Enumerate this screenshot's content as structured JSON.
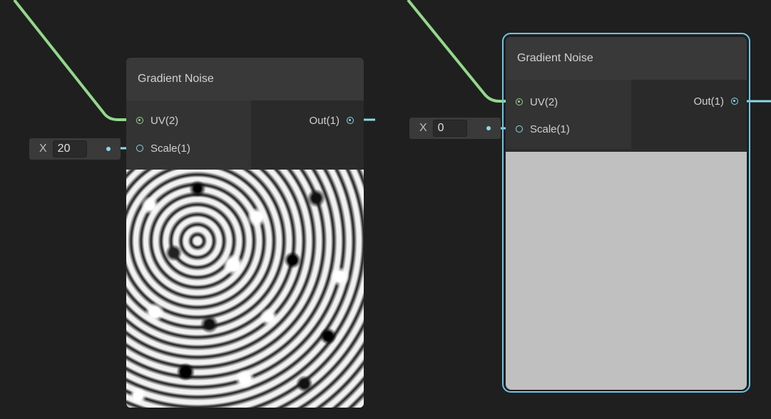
{
  "colors": {
    "background": "#1f1f1f",
    "uv_wire": "#93d88b",
    "float_wire": "#8ad8e8",
    "selection": "#6cc6e6"
  },
  "nodes": [
    {
      "title": "Gradient Noise",
      "input_uv": "UV(2)",
      "input_scale": "Scale(1)",
      "output": "Out(1)",
      "scale_axis": "X",
      "scale_value": "20",
      "preview": "noise"
    },
    {
      "title": "Gradient Noise",
      "input_uv": "UV(2)",
      "input_scale": "Scale(1)",
      "output": "Out(1)",
      "scale_axis": "X",
      "scale_value": "0",
      "preview": "flat-gray",
      "selected": true
    }
  ]
}
